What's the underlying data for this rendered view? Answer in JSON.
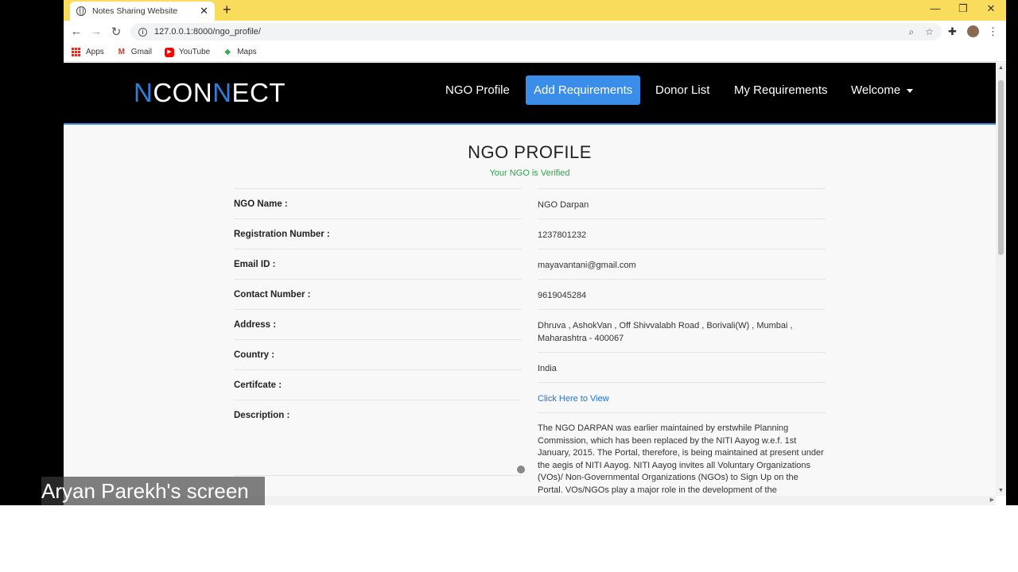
{
  "browser": {
    "tab_title": "Notes Sharing Website",
    "url": "127.0.0.1:8000/ngo_profile/",
    "bookmarks": [
      {
        "label": "Apps",
        "icon": "apps-grid-icon"
      },
      {
        "label": "Gmail",
        "icon": "gmail-icon"
      },
      {
        "label": "YouTube",
        "icon": "youtube-icon"
      },
      {
        "label": "Maps",
        "icon": "maps-icon"
      }
    ],
    "colors": {
      "tabstrip": "#f9dc5c"
    }
  },
  "site": {
    "brand_part1": "N",
    "brand_part2": "CON",
    "brand_part3": "N",
    "brand_part4": "ECT",
    "nav": {
      "profile": "NGO Profile",
      "add_req": "Add Requirements",
      "donors": "Donor List",
      "my_req": "My Requirements",
      "welcome": "Welcome"
    },
    "colors": {
      "accent": "#3a8de8",
      "brand_blue": "#2f7fd8",
      "verified": "#28a745"
    }
  },
  "profile": {
    "heading": "NGO PROFILE",
    "verified": "Your NGO is Verified",
    "rows": [
      {
        "label": "NGO Name :",
        "value": "NGO Darpan"
      },
      {
        "label": "Registration Number :",
        "value": "1237801232"
      },
      {
        "label": "Email ID :",
        "value": "mayavantani@gmail.com"
      },
      {
        "label": "Contact Number :",
        "value": "9619045284"
      },
      {
        "label": "Address :",
        "value": "Dhruva , AshokVan , Off Shivvalabh Road , Borivali(W) , Mumbai , Maharashtra - 400067"
      },
      {
        "label": "Country :",
        "value": "India"
      },
      {
        "label": "Certifcate :",
        "value": "Click Here to View"
      },
      {
        "label": "Description :",
        "value": "The NGO DARPAN was earlier maintained by erstwhile Planning Commission, which has been replaced by the NITI Aayog w.e.f. 1st January, 2015. The Portal, therefore, is being maintained at present under the aegis of NITI Aayog. NITI Aayog invites all Voluntary Organizations (VOs)/ Non-Governmental Organizations (NGOs) to Sign Up on the Portal. VOs/NGOs play a major role in the development of the"
      }
    ]
  },
  "overlay": {
    "presenter": "Aryan Parekh's screen"
  }
}
